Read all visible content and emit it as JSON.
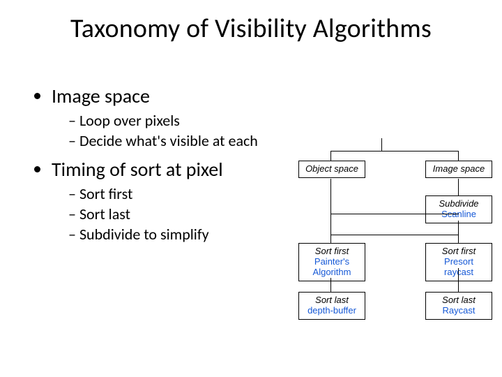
{
  "title": "Taxonomy of Visibility Algorithms",
  "bullets": {
    "b1": "Image space",
    "b1s1": "Loop over pixels",
    "b1s2": "Decide what's visible at each",
    "b2": "Timing of sort at pixel",
    "b2s1": "Sort first",
    "b2s2": "Sort last",
    "b2s3": "Subdivide to simplify"
  },
  "diagram": {
    "object_space": "Object space",
    "image_space": "Image space",
    "subdivide": "Subdivide",
    "scanline": "Scanline",
    "sort_first": "Sort first",
    "painters": "Painter's Algorithm",
    "presort_raycast": "Presort raycast",
    "sort_last": "Sort last",
    "depth_buffer": "depth-buffer",
    "raycast": "Raycast"
  }
}
